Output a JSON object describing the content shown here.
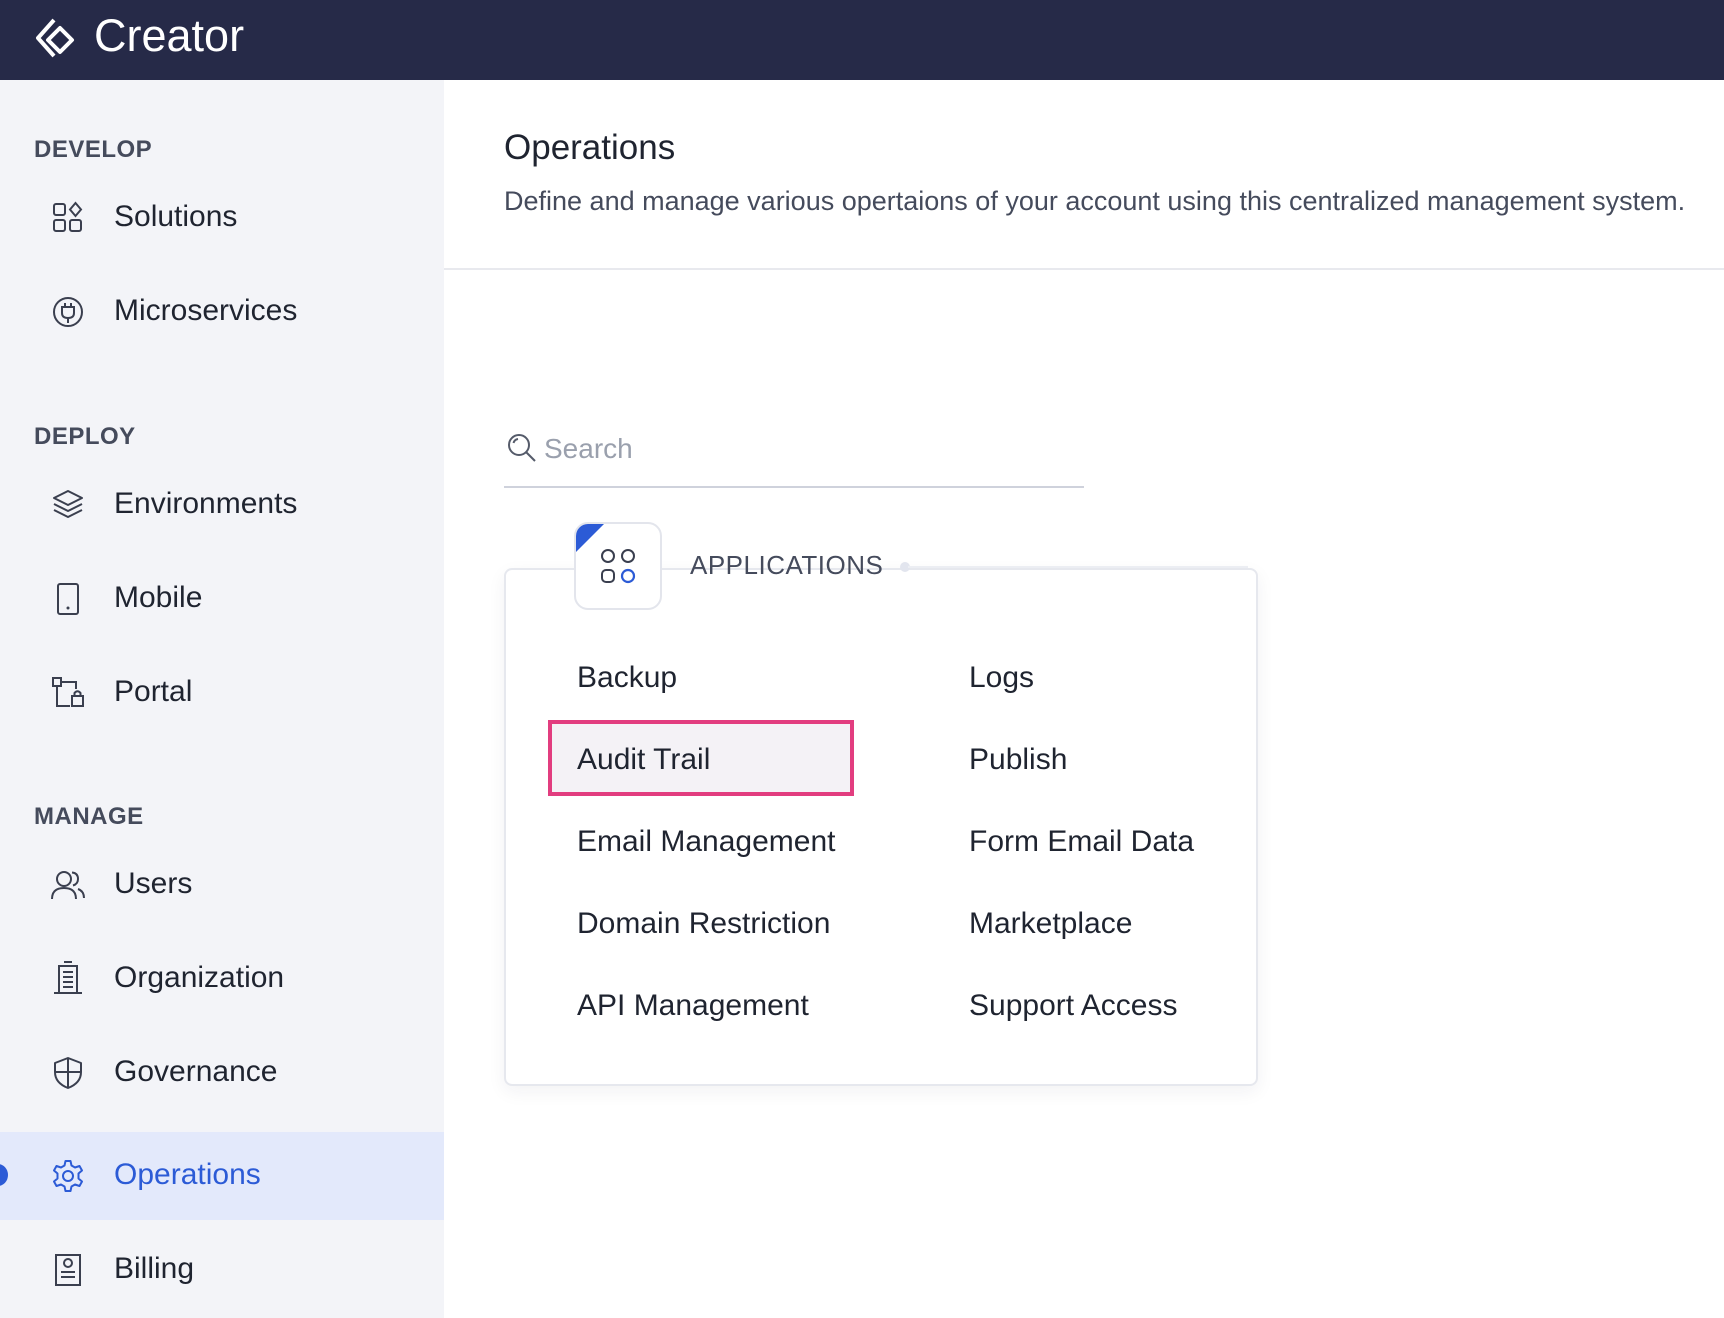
{
  "header": {
    "app_title": "Creator"
  },
  "sidebar": {
    "sections": [
      {
        "title": "DEVELOP"
      },
      {
        "title": "DEPLOY"
      },
      {
        "title": "MANAGE"
      }
    ],
    "items": [
      {
        "label": "Solutions",
        "icon": "solutions-icon"
      },
      {
        "label": "Microservices",
        "icon": "microservices-icon"
      },
      {
        "label": "Environments",
        "icon": "layers-icon"
      },
      {
        "label": "Mobile",
        "icon": "mobile-icon"
      },
      {
        "label": "Portal",
        "icon": "portal-icon"
      },
      {
        "label": "Users",
        "icon": "users-icon"
      },
      {
        "label": "Organization",
        "icon": "building-icon"
      },
      {
        "label": "Governance",
        "icon": "shield-icon"
      },
      {
        "label": "Operations",
        "icon": "gear-icon",
        "active": true
      },
      {
        "label": "Billing",
        "icon": "billing-icon"
      }
    ]
  },
  "main": {
    "title": "Operations",
    "description": "Define and manage various opertaions of your account using this centralized management system.",
    "search": {
      "placeholder": "Search",
      "value": ""
    },
    "card": {
      "heading": "APPLICATIONS",
      "icon": "applications-icon",
      "items": [
        {
          "label": "Backup"
        },
        {
          "label": "Logs"
        },
        {
          "label": "Audit Trail",
          "highlighted": true
        },
        {
          "label": "Publish"
        },
        {
          "label": "Email Management"
        },
        {
          "label": "Form Email Data"
        },
        {
          "label": "Domain Restriction"
        },
        {
          "label": "Marketplace"
        },
        {
          "label": "API Management"
        },
        {
          "label": "Support Access"
        }
      ]
    }
  },
  "colors": {
    "topbar": "#262a48",
    "accent": "#2c5bd6",
    "highlight_border": "#e23d7f",
    "sidebar_bg": "#f3f4f8"
  }
}
